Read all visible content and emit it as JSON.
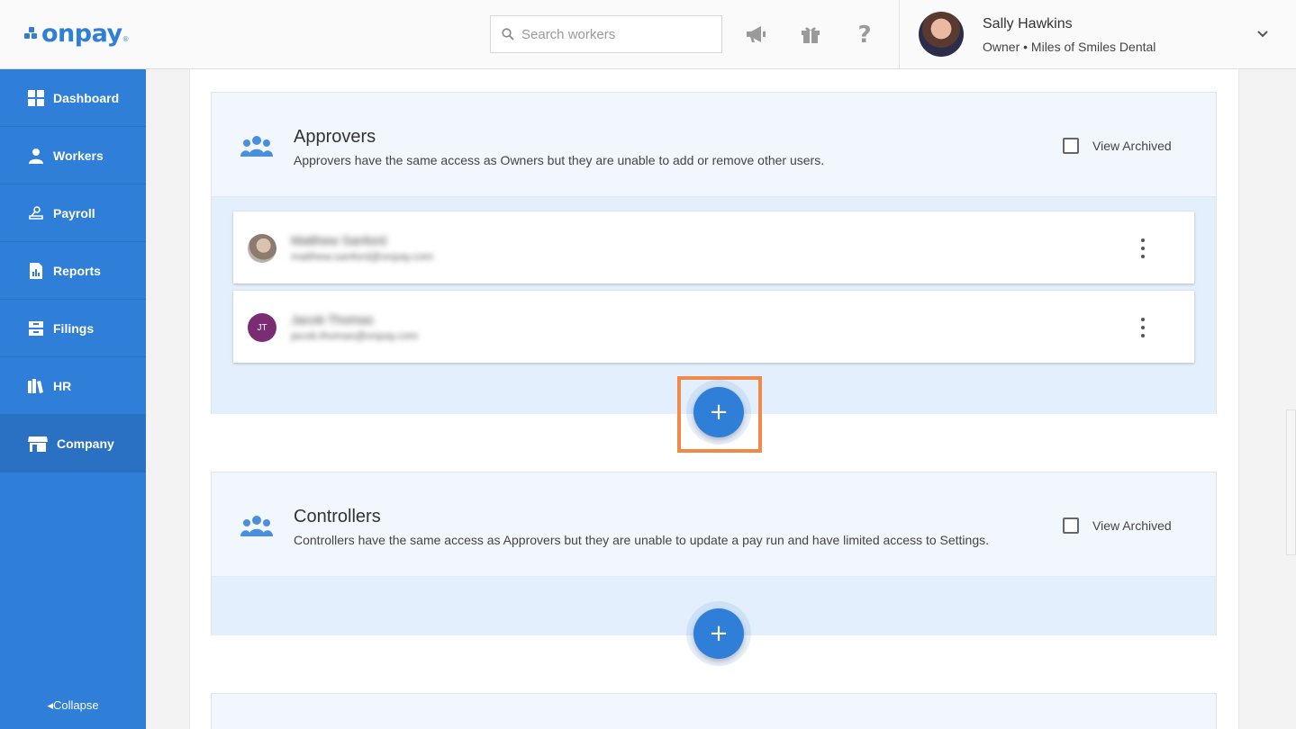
{
  "brand": {
    "name": "onpay",
    "reg": "®"
  },
  "search": {
    "placeholder": "Search workers"
  },
  "header_icons": [
    "megaphone-icon",
    "gift-icon",
    "help-icon"
  ],
  "user": {
    "name": "Sally Hawkins",
    "role": "Owner • Miles of Smiles Dental"
  },
  "nav": {
    "items": [
      {
        "label": "Dashboard",
        "icon": "dashboard-icon"
      },
      {
        "label": "Workers",
        "icon": "workers-icon"
      },
      {
        "label": "Payroll",
        "icon": "payroll-icon"
      },
      {
        "label": "Reports",
        "icon": "reports-icon"
      },
      {
        "label": "Filings",
        "icon": "filings-icon"
      },
      {
        "label": "HR",
        "icon": "hr-icon"
      },
      {
        "label": "Company",
        "icon": "company-icon",
        "active": true
      }
    ],
    "collapse_label": "Collapse"
  },
  "approvers": {
    "title": "Approvers",
    "description": "Approvers have the same access as Owners but they are unable to add or remove other users.",
    "view_archived": "View Archived",
    "users": [
      {
        "name": "Matthew Sanford",
        "email": "matthew.sanford@onpay.com",
        "initials": ""
      },
      {
        "name": "Jacob Thomas",
        "email": "jacob.thomas@onpay.com",
        "initials": "JT"
      }
    ],
    "add_label": "+"
  },
  "controllers": {
    "title": "Controllers",
    "description": "Controllers have the same access as Approvers but they are unable to update a pay run and have limited access to Settings.",
    "view_archived": "View Archived",
    "add_label": "+"
  },
  "colors": {
    "primary": "#2f7ed8",
    "highlight": "#ef8a48",
    "avatar_purple": "#7b2d73"
  }
}
